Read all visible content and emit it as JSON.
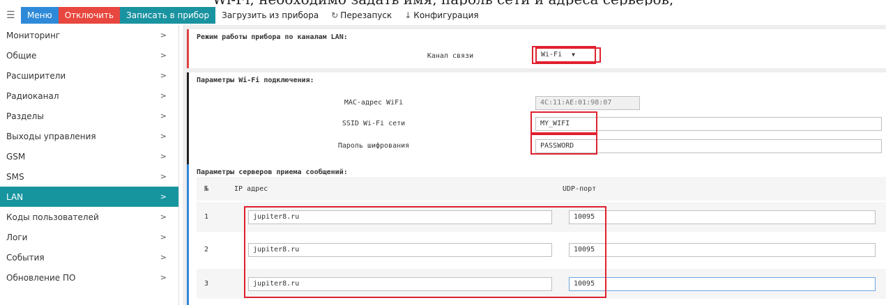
{
  "caption_text": "Wi-Fi, необходимо задать имя, пароль сети и адреса серверов,",
  "toolbar": {
    "menu_label": "Меню",
    "disconnect_label": "Отключить",
    "write_label": "Записать в прибор",
    "load_label": "Загрузить из прибора",
    "restart_label": "Перезапуск",
    "config_label": "Конфигурация",
    "colors": {
      "menu": "#2e8ad8",
      "disconnect": "#e8473f",
      "write": "#1a93a0"
    }
  },
  "sidebar": {
    "active_color": "#17959f",
    "items": [
      {
        "label": "Мониторинг",
        "chevron": ">"
      },
      {
        "label": "Общие",
        "chevron": ">"
      },
      {
        "label": "Расширители",
        "chevron": ">"
      },
      {
        "label": "Радиоканал",
        "chevron": ">"
      },
      {
        "label": "Разделы",
        "chevron": ">"
      },
      {
        "label": "Выходы управления",
        "chevron": ">"
      },
      {
        "label": "GSM",
        "chevron": ">"
      },
      {
        "label": "SMS",
        "chevron": ">"
      },
      {
        "label": "LAN",
        "chevron": ">",
        "active": true
      },
      {
        "label": "Коды пользователей",
        "chevron": ">"
      },
      {
        "label": "Логи",
        "chevron": ">"
      },
      {
        "label": "События",
        "chevron": ">"
      },
      {
        "label": "Обновление ПО",
        "chevron": ">"
      }
    ]
  },
  "lan_mode": {
    "title": "Режим работы прибора по каналам LAN:",
    "channel_label": "Канал связи",
    "channel_value": "Wi-Fi"
  },
  "wifi": {
    "title": "Параметры Wi-Fi подключения:",
    "mac_label": "MAC-адрес WiFi",
    "mac_value": "4C:11:AE:01:98:07",
    "ssid_label": "SSID Wi-Fi сети",
    "ssid_value": "MY_WIFI",
    "password_label": "Пароль шифрования",
    "password_value": "PASSWORD"
  },
  "servers": {
    "title": "Параметры серверов приема сообщений:",
    "columns": {
      "num": "№",
      "ip": "IP адрес",
      "port": "UDP-порт"
    },
    "rows": [
      {
        "num": "1",
        "ip": "jupiter8.ru",
        "port": "10095"
      },
      {
        "num": "2",
        "ip": "jupiter8.ru",
        "port": "10095"
      },
      {
        "num": "3",
        "ip": "jupiter8.ru",
        "port": "10095"
      }
    ]
  },
  "highlight_color": "#e0202f"
}
